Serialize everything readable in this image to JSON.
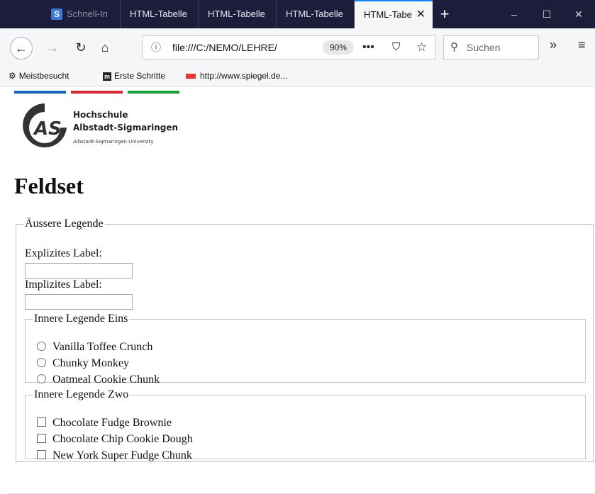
{
  "browser": {
    "tabs": [
      {
        "label": "Schnell-In",
        "favicon": "S"
      },
      {
        "label": "HTML-Tabelle"
      },
      {
        "label": "HTML-Tabelle"
      },
      {
        "label": "HTML-Tabelle"
      },
      {
        "label": "HTML-Tabe",
        "active": true
      }
    ],
    "new_tab_label": "+",
    "window_controls": {
      "minimize": "–",
      "maximize": "☐",
      "close": "✕"
    },
    "url": "file:///C:/NEMO/LEHRE/",
    "zoom": "90%",
    "page_actions": "•••",
    "search_placeholder": "Suchen",
    "overflow": "»",
    "menu": "≡",
    "bookmarks": [
      {
        "label": "Meistbesucht",
        "icon": "gear-icon"
      },
      {
        "label": "Erste Schritte",
        "icon": "mozilla-icon",
        "icon_text": "m"
      },
      {
        "label": "http://www.spiegel.de...",
        "icon": "spiegel-icon"
      }
    ]
  },
  "page": {
    "stripes": [
      "#1565c0",
      "#e0242f",
      "#17a33a"
    ],
    "logo": {
      "line1": "Hochschule",
      "line2": "Albstadt-Sigmaringen",
      "line3": "Albstadt-Sigmaringen University"
    },
    "heading": "Feldset",
    "outer_fieldset": {
      "legend": "Äussere Legende",
      "explicit_label": "Explizites Label:",
      "explicit_value": "",
      "implicit_label": "Implizites Label:",
      "implicit_value": "",
      "inner1": {
        "legend": "Innere Legende Eins",
        "radios": [
          "Vanilla Toffee Crunch",
          "Chunky Monkey",
          "Oatmeal Cookie Chunk"
        ]
      },
      "inner2": {
        "legend": "Innere Legende Zwo",
        "checkboxes": [
          "Chocolate Fudge Brownie",
          "Chocolate Chip Cookie Dough",
          "New York Super Fudge Chunk"
        ]
      }
    }
  }
}
